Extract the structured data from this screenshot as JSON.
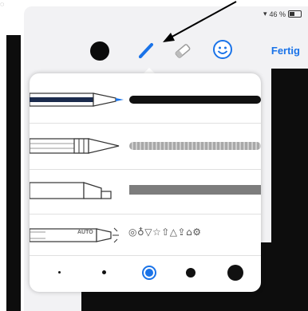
{
  "status": {
    "battery_text": "46 %"
  },
  "toolbar": {
    "done_label": "Fertig",
    "color_selected": "#0b0b0b",
    "accent": "#1a73e8",
    "icons": [
      "color-swatch-icon",
      "pen-icon",
      "eraser-icon",
      "smiley-icon"
    ]
  },
  "popover": {
    "tools": [
      {
        "name": "pen",
        "stroke_color": "#111111"
      },
      {
        "name": "pencil",
        "stroke_color": "#9a9a9a"
      },
      {
        "name": "marker",
        "stroke_color": "#7d7d7d"
      },
      {
        "name": "auto-shapes",
        "label": "AUTO",
        "preview": "◎♁▽☆⇧△⇪⌂⚙"
      }
    ],
    "sizes": [
      "xs",
      "s",
      "m",
      "l",
      "xl"
    ],
    "selected_size": "m"
  }
}
